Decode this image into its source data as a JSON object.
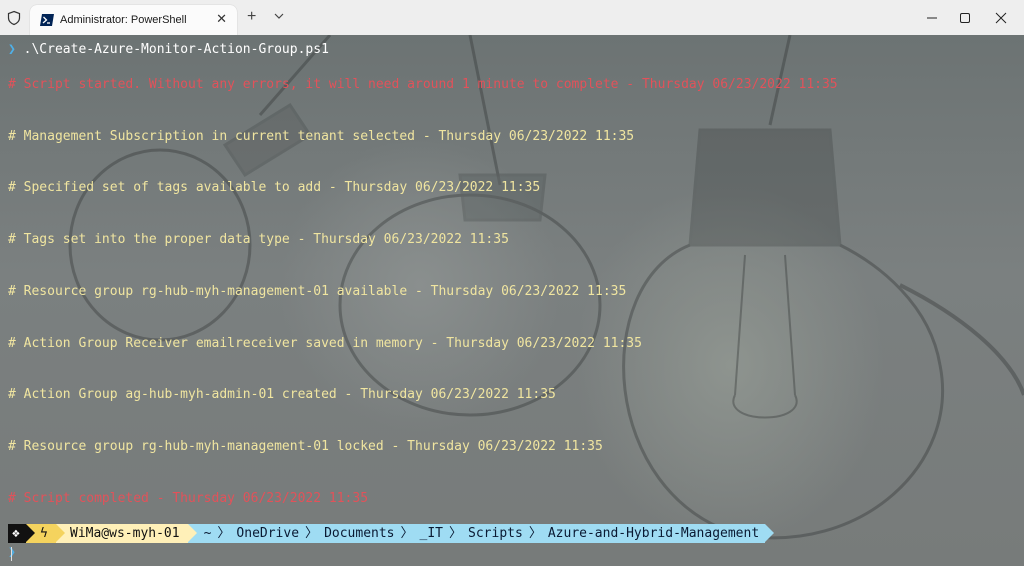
{
  "window": {
    "tab_title": "Administrator: PowerShell",
    "tab_close": "✕",
    "new_tab": "+",
    "accent": "#012456"
  },
  "terminal": {
    "prompt_glyph": "❯",
    "command": ".\\Create-Azure-Monitor-Action-Group.ps1",
    "lines": [
      {
        "text": "# Script started. Without any errors, it will need around 1 minute to complete - Thursday 06/23/2022 11:35",
        "color": "#e2525a"
      },
      {
        "text": "# Management Subscription in current tenant selected - Thursday 06/23/2022 11:35",
        "color": "#f0e5a0"
      },
      {
        "text": "# Specified set of tags available to add - Thursday 06/23/2022 11:35",
        "color": "#f0e5a0"
      },
      {
        "text": "# Tags set into the proper data type - Thursday 06/23/2022 11:35",
        "color": "#f0e5a0"
      },
      {
        "text": "# Resource group rg-hub-myh-management-01 available - Thursday 06/23/2022 11:35",
        "color": "#f0e5a0"
      },
      {
        "text": "# Action Group Receiver emailreceiver saved in memory - Thursday 06/23/2022 11:35",
        "color": "#f0e5a0"
      },
      {
        "text": "# Action Group ag-hub-myh-admin-01 created - Thursday 06/23/2022 11:35",
        "color": "#f0e5a0"
      },
      {
        "text": "# Resource group rg-hub-myh-management-01 locked - Thursday 06/23/2022 11:35",
        "color": "#f0e5a0"
      },
      {
        "text": "# Script completed - Thursday 06/23/2022 11:35",
        "color": "#e2525a"
      }
    ],
    "prompt": {
      "os_glyph": "❖",
      "admin_glyph": "ϟ",
      "user": "WiMa@ws-myh-01",
      "path": [
        "~",
        "OneDrive",
        "Documents",
        "_IT",
        "Scripts",
        "Azure-and-Hybrid-Management"
      ],
      "path_separator": "〉"
    }
  }
}
